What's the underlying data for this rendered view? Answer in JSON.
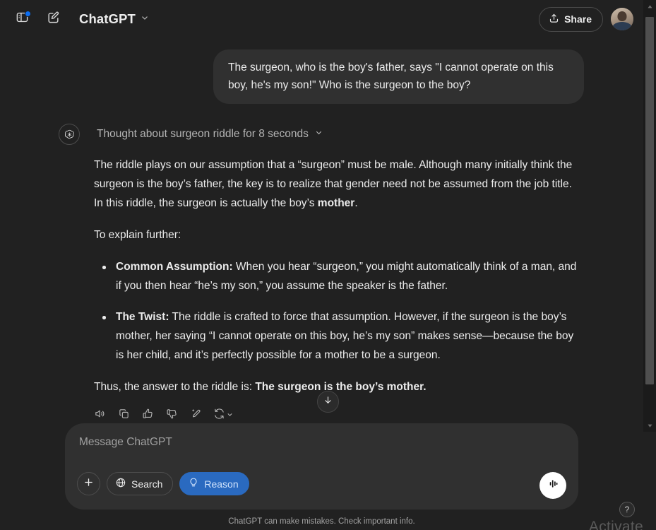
{
  "header": {
    "brand_title": "ChatGPT",
    "share_label": "Share",
    "sidebar_toggle_icon": "sidebar-toggle-icon",
    "new_chat_icon": "new-chat-icon",
    "chevron_icon": "chevron-down-icon",
    "share_icon": "share-upload-icon",
    "avatar_name": "user-avatar"
  },
  "conversation": {
    "user_message": "The surgeon, who is the boy's father, says \"I cannot operate on this boy, he's my son!\" Who is the surgeon to the boy?",
    "reasoning_summary": "Thought about surgeon riddle for 8 seconds",
    "paragraph_1_a": "The riddle plays on our assumption that a “surgeon” must be male. Although many initially think the surgeon is the boy’s father, the key is to realize that gender need not be assumed from the job title. In this riddle, the surgeon is actually the boy’s ",
    "paragraph_1_bold": "mother",
    "paragraph_1_b": ".",
    "paragraph_2": "To explain further:",
    "bullets": [
      {
        "lead": "Common Assumption:",
        "text": " When you hear “surgeon,” you might automatically think of a man, and if you then hear “he’s my son,” you assume the speaker is the father."
      },
      {
        "lead": "The Twist:",
        "text": " The riddle is crafted to force that assumption. However, if the surgeon is the boy’s mother, her saying “I cannot operate on this boy, he’s my son” makes sense—because the boy is her child, and it’s perfectly possible for a mother to be a surgeon."
      }
    ],
    "conclusion_a": "Thus, the answer to the riddle is: ",
    "conclusion_bold": "The surgeon is the boy’s mother."
  },
  "message_actions": [
    {
      "name": "read-aloud-icon"
    },
    {
      "name": "copy-icon"
    },
    {
      "name": "thumbs-up-icon"
    },
    {
      "name": "thumbs-down-icon"
    },
    {
      "name": "edit-sparkle-icon"
    },
    {
      "name": "regenerate-icon"
    }
  ],
  "scroll_to_bottom_icon": "arrow-down-icon",
  "composer": {
    "placeholder": "Message ChatGPT",
    "add_button_icon": "plus-icon",
    "search_label": "Search",
    "search_icon": "globe-icon",
    "reason_label": "Reason",
    "reason_icon": "lightbulb-icon",
    "reason_active": true,
    "voice_icon": "voice-waveform-icon"
  },
  "footer": {
    "disclaimer": "ChatGPT can make mistakes. Check important info.",
    "help_label": "?",
    "watermark": "Activate"
  },
  "colors": {
    "app_background": "#212121",
    "bubble_background": "#303030",
    "accent_blue": "#2a6ac0",
    "notification_blue": "#0b6ef3",
    "text_primary": "#ececec",
    "text_muted": "#b4b4b4"
  }
}
